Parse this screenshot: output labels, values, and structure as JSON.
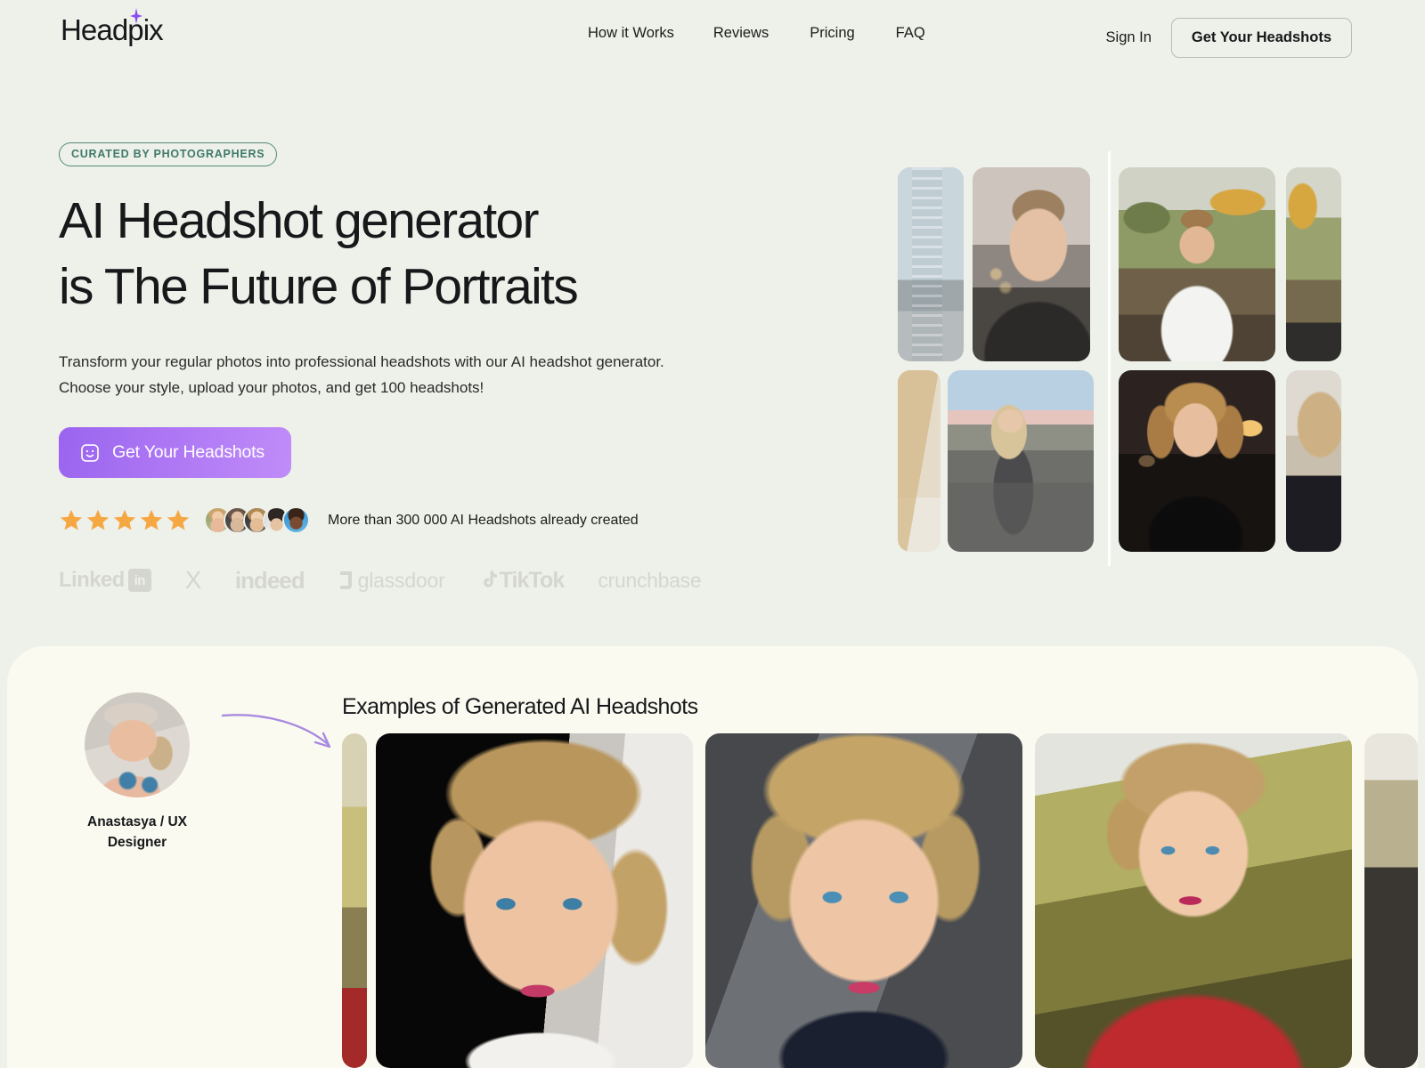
{
  "brand": {
    "name": "Headpix",
    "spark_icon": "sparkle-icon",
    "accent_purple": "#a16bf0",
    "badge_teal": "#3f7a6a",
    "star_orange": "#f5a742",
    "hero_bg": "#eef0ea",
    "examples_bg": "#fbfaf1"
  },
  "nav": {
    "links": [
      {
        "label": "How it Works",
        "name": "nav-link-how-it-works"
      },
      {
        "label": "Reviews",
        "name": "nav-link-reviews"
      },
      {
        "label": "Pricing",
        "name": "nav-link-pricing"
      },
      {
        "label": "FAQ",
        "name": "nav-link-faq"
      }
    ],
    "sign_in": "Sign In",
    "cta": "Get Your Headshots"
  },
  "hero": {
    "badge": "CURATED BY PHOTOGRAPHERS",
    "headline_line1": "AI Headshot generator",
    "headline_line2": "is The Future of Portraits",
    "subcopy_line1": "Transform your regular photos into professional headshots with our AI headshot generator.",
    "subcopy_line2": "Choose your style, upload your photos, and get 100 headshots!",
    "cta_label": "Get Your Headshots",
    "cta_icon": "smiley-face-icon",
    "rating_stars": 5,
    "proof_text": "More than 300 000 AI Headshots already created",
    "avatar_count": 5,
    "brands": [
      {
        "label": "Linked",
        "badge": "in",
        "name": "brand-logo-linkedin"
      },
      {
        "label": "X",
        "badge": "",
        "name": "brand-logo-x"
      },
      {
        "label": "indeed",
        "badge": "",
        "name": "brand-logo-indeed"
      },
      {
        "label": "glassdoor",
        "badge": "",
        "name": "brand-logo-glassdoor"
      },
      {
        "label": "TikTok",
        "badge": "",
        "name": "brand-logo-tiktok"
      },
      {
        "label": "crunchbase",
        "badge": "",
        "name": "brand-logo-crunchbase"
      }
    ]
  },
  "collage": {
    "tiles": [
      {
        "name": "collage-before-partial-left-top",
        "alt": "blurred balcony photo"
      },
      {
        "name": "collage-before-man-selfie",
        "alt": "man selfie on foggy street"
      },
      {
        "name": "collage-after-man-park",
        "alt": "AI headshot man in white sweater"
      },
      {
        "name": "collage-after-partial-right-top",
        "alt": "partial autumn portrait"
      },
      {
        "name": "collage-before-partial-left-bottom",
        "alt": "blurred blonde hair"
      },
      {
        "name": "collage-before-woman-rooftop",
        "alt": "woman on rooftop in leather jacket"
      },
      {
        "name": "collage-after-woman-suit",
        "alt": "AI headshot woman in black suit"
      },
      {
        "name": "collage-after-partial-right-bottom",
        "alt": "partial blonde portrait"
      }
    ]
  },
  "examples": {
    "title": "Examples of Generated AI Headshots",
    "persona_name_line1": "Anastasya / UX",
    "persona_name_line2": "Designer",
    "persona_avatar_alt": "Anastasya source photo",
    "arrow_icon": "curved-arrow-icon",
    "cards": [
      {
        "name": "example-headshot-partial-left",
        "alt": "partial headshot red jacket"
      },
      {
        "name": "example-headshot-1",
        "alt": "blonde woman white shirt dark background"
      },
      {
        "name": "example-headshot-2",
        "alt": "blonde woman navy top grey background"
      },
      {
        "name": "example-headshot-3",
        "alt": "woman in red blazer outdoors"
      },
      {
        "name": "example-headshot-partial-right",
        "alt": "partial headshot dark"
      }
    ]
  }
}
